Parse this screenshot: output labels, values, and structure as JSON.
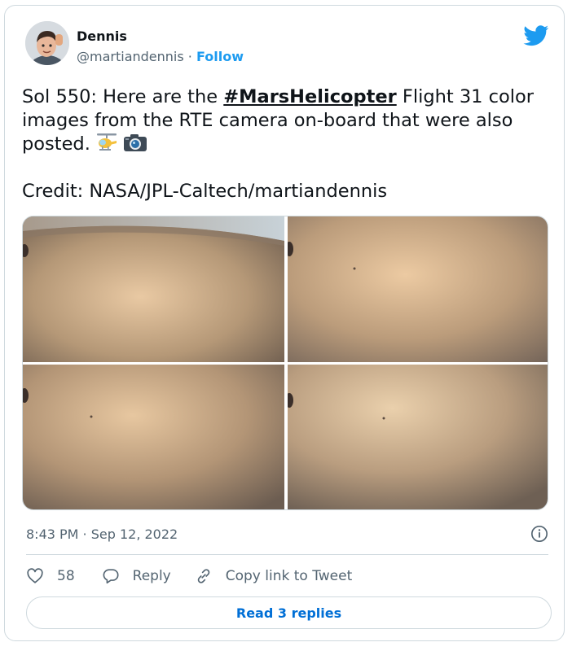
{
  "author": {
    "name": "Dennis",
    "handle": "@martiandennis",
    "separator": "·",
    "follow_label": "Follow"
  },
  "tweet": {
    "text_prefix": "Sol 550: Here are the ",
    "hashtag": "#MarsHelicopter",
    "text_suffix": " Flight 31 color images from the RTE camera on-board that were also posted.",
    "emojis": [
      "helicopter-emoji",
      "camera-emoji"
    ],
    "credit": "Credit: NASA/JPL-Caltech/martiandennis"
  },
  "media": {
    "images": [
      {
        "name": "mars-image-1",
        "has_horizon": true
      },
      {
        "name": "mars-image-2",
        "has_horizon": false
      },
      {
        "name": "mars-image-3",
        "has_horizon": false
      },
      {
        "name": "mars-image-4",
        "has_horizon": false
      }
    ]
  },
  "meta": {
    "timestamp": "8:43 PM · Sep 12, 2022"
  },
  "actions": {
    "like_count": "58",
    "reply_label": "Reply",
    "copy_label": "Copy link to Tweet"
  },
  "footer": {
    "read_replies_label": "Read 3 replies"
  },
  "colors": {
    "accent": "#1d9bf0",
    "link_blue": "#006fd6",
    "muted": "#536471",
    "border": "#cfd9de"
  }
}
